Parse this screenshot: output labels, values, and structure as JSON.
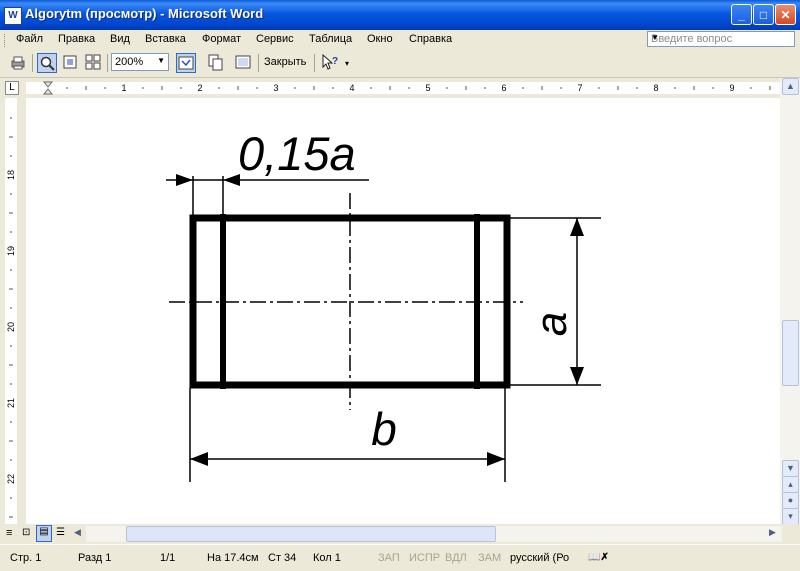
{
  "window": {
    "title": "Algorytm (просмотр) - Microsoft Word",
    "app_icon": "W"
  },
  "caption_buttons": {
    "minimize": "_",
    "maximize": "□",
    "close": "✕"
  },
  "menu": [
    "Файл",
    "Правка",
    "Вид",
    "Вставка",
    "Формат",
    "Сервис",
    "Таблица",
    "Окно",
    "Справка"
  ],
  "ask_box": {
    "placeholder": "Введите вопрос"
  },
  "toolbar": {
    "zoom": "200%",
    "close_label": "Закрыть"
  },
  "ruler": {
    "horizontal_numbers": [
      "1",
      "2",
      "3",
      "4",
      "5",
      "6",
      "7",
      "8",
      "9"
    ],
    "vertical_numbers": [
      "18",
      "19",
      "20",
      "21",
      "22"
    ]
  },
  "drawing": {
    "label_top": "0,15a",
    "label_side": "a",
    "label_bottom": "b"
  },
  "statusbar": {
    "page": "Стр. 1",
    "section": "Разд 1",
    "pages": "1/1",
    "at": "На 17.4см",
    "line": "Ст 34",
    "col": "Кол 1",
    "rec": "ЗАП",
    "trk": "ИСПР",
    "ext": "ВДЛ",
    "ovr": "ЗАМ",
    "language": "русский (Ро"
  }
}
